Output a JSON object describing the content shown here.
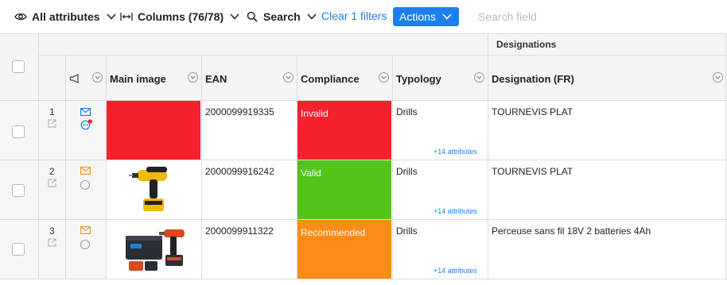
{
  "toolbar": {
    "attributes_label": "All attributes",
    "columns_label": "Columns (76/78)",
    "search_label": "Search",
    "clear_filters_label": "Clear 1 filters",
    "actions_label": "Actions",
    "search_placeholder": "Search field"
  },
  "table": {
    "group_header": "Designations",
    "columns": [
      "Main image",
      "EAN",
      "Compliance",
      "Typology",
      "Designation (FR)"
    ],
    "rows": [
      {
        "num": "1",
        "ean": "2000099919335",
        "compliance": "Invalid",
        "typology": "Drills",
        "more": "+14 attributes",
        "designation": "TOURNEVIS PLAT"
      },
      {
        "num": "2",
        "ean": "2000099916242",
        "compliance": "Valid",
        "typology": "Drills",
        "more": "+14 attributes",
        "designation": "TOURNEVIS PLAT"
      },
      {
        "num": "3",
        "ean": "2000099911322",
        "compliance": "Recommended",
        "typology": "Drills",
        "more": "+14 attributes",
        "designation": "Perceuse sans fil 18V 2 batteries 4Ah"
      }
    ]
  },
  "colors": {
    "accent": "#1b7ff0",
    "invalid": "#f5222d",
    "valid": "#52c41a",
    "recommended": "#fa8c16",
    "mail_blue": "#1b7ff0",
    "mail_orange": "#f09a2a",
    "notification_dot": "#f5222d"
  },
  "icons": {
    "attributes": "eye-icon",
    "columns": "column-width-icon",
    "search": "search-icon",
    "dropdown": "chevron-down-icon",
    "announce": "megaphone-icon",
    "column_menu": "chevron-circle-icon",
    "edit": "external-edit-icon",
    "mail": "envelope-icon",
    "comment": "comment-icon",
    "status": "circle-icon"
  }
}
